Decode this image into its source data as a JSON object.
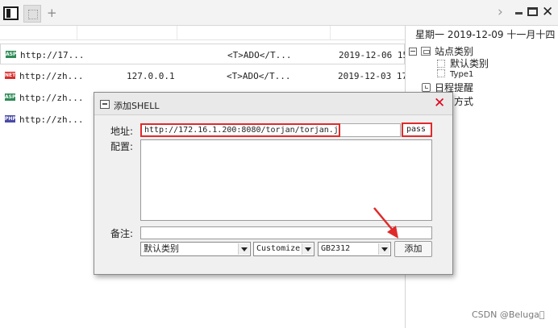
{
  "window": {
    "tabs": [
      {
        "name": "active-tab"
      },
      {
        "name": "second-tab"
      }
    ],
    "add_tab": "+",
    "chevron": "›",
    "close": "✕"
  },
  "list": {
    "rows": [
      {
        "type": "ASP",
        "badge_color": "#2e8b57",
        "url": "http://17...",
        "ip": "",
        "info": "<T>ADO</T...",
        "date": "2019-12-06 15:"
      },
      {
        "type": "NET",
        "badge_color": "#d62d2d",
        "url": "http://zh...",
        "ip": "127.0.0.1",
        "info": "<T>ADO</T...",
        "date": "2019-12-03 17:"
      },
      {
        "type": "ASP",
        "badge_color": "#2e8b57",
        "url": "http://zh...",
        "ip": "",
        "info": "",
        "date": ""
      },
      {
        "type": "PHP",
        "badge_color": "#4a4aa8",
        "url": "http://zh...",
        "ip": "",
        "info": "",
        "date": ""
      }
    ]
  },
  "sidebar": {
    "date": "星期一 2019-12-09 十一月十四",
    "tree": {
      "category_root": "站点类别",
      "default_category": "默认类别",
      "type1": "Type1",
      "schedule": "日程提醒",
      "other": "方式"
    }
  },
  "dialog": {
    "title": "添加SHELL",
    "address_label": "地址:",
    "address_value": "http://172.16.1.200:8080/torjan/torjan.jsp",
    "password_value": "pass",
    "config_label": "配置:",
    "note_label": "备注:",
    "category_select": "默认类别",
    "mode_select": "Customize",
    "encoding_select": "GB2312",
    "add_button": "添加",
    "close_icon": "✕"
  },
  "colors": {
    "highlight": "#e02a2a",
    "close_red": "#e2001a"
  },
  "watermark": "CSDN @Beluga\u0000"
}
